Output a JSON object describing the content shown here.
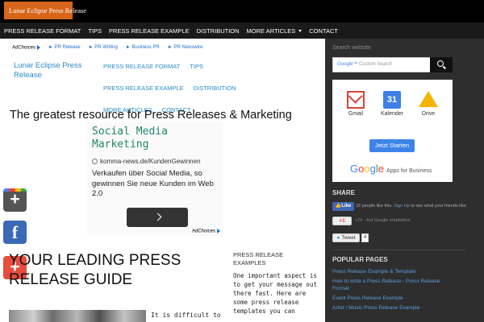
{
  "topbar": {
    "logo_text": "Lunar Eclipse Press Release"
  },
  "nav": {
    "items": [
      "PRESS RELEASE FORMAT",
      "TIPS",
      "PRESS RELEASE EXAMPLE",
      "DISTRIBUTION",
      "MORE ARTICLES",
      "CONTACT"
    ]
  },
  "main": {
    "adbar": {
      "adchoices": "AdChoices",
      "links": [
        "► PR Release",
        "► PR Writing",
        "► Business PR",
        "► PR Newswire"
      ]
    },
    "site_title": "Lunar Eclipse Press Release",
    "secondary_nav": [
      "PRESS RELEASE FORMAT",
      "TIPS",
      "PRESS RELEASE EXAMPLE",
      "DISTRIBUTION",
      "MORE ARTICLES",
      "CONTACT"
    ],
    "headline": "The greatest resource for Press Releases & Marketing",
    "ad": {
      "title": "Social Media Marketing",
      "url": "komma-news.de/KundenGewinnen",
      "text": "Verkaufen über Social Media, so gewinnen Sie neue Kunden im Web 2.0",
      "adchoices": "AdChoices"
    },
    "lead_title": "YOUR LEADING PRESS RELEASE GUIDE",
    "lead_text": "It is difficult to",
    "examples_heading": "PRESS RELEASE EXAMPLES",
    "examples_text": "One important aspect is to get your message out there fast. Here are some press release templates you can"
  },
  "share_buttons": {
    "google_plus_glyph": "+",
    "facebook_glyph": "f",
    "addthis_glyph": "+"
  },
  "sidebar": {
    "search_label": "Search website",
    "search_placeholder_brand": "Google™",
    "search_placeholder": "Custom Search",
    "google_ad": {
      "apps": [
        "Gmail",
        "Kalender",
        "Drive"
      ],
      "calendar_number": "31",
      "button": "Jetzt Starten",
      "brand": "Google",
      "brand_suffix": "Apps for Business"
    },
    "share_heading": "SHARE",
    "like_button": "Like",
    "like_count_text": "32 people like this.",
    "like_signup": "Sign Up",
    "like_suffix": "to see what your friends like.",
    "gplus_button": "+1",
    "gplus_text": "+79 · Auf Google empfehlen",
    "tweet_button": "Tweet",
    "tweet_count": "4",
    "popular_heading": "POPULAR PAGES",
    "popular_pages": [
      "Press Release Example & Template",
      "How to write a Press Release - Press Release Format",
      "Event Press Release Example",
      "Artist / Music Press Release Example"
    ]
  },
  "colors": {
    "accent_orange": "#d7661b",
    "link_blue": "#2a8cc9",
    "sidebar_bg": "#2e2e2e",
    "ad_title_green": "#22866b"
  }
}
